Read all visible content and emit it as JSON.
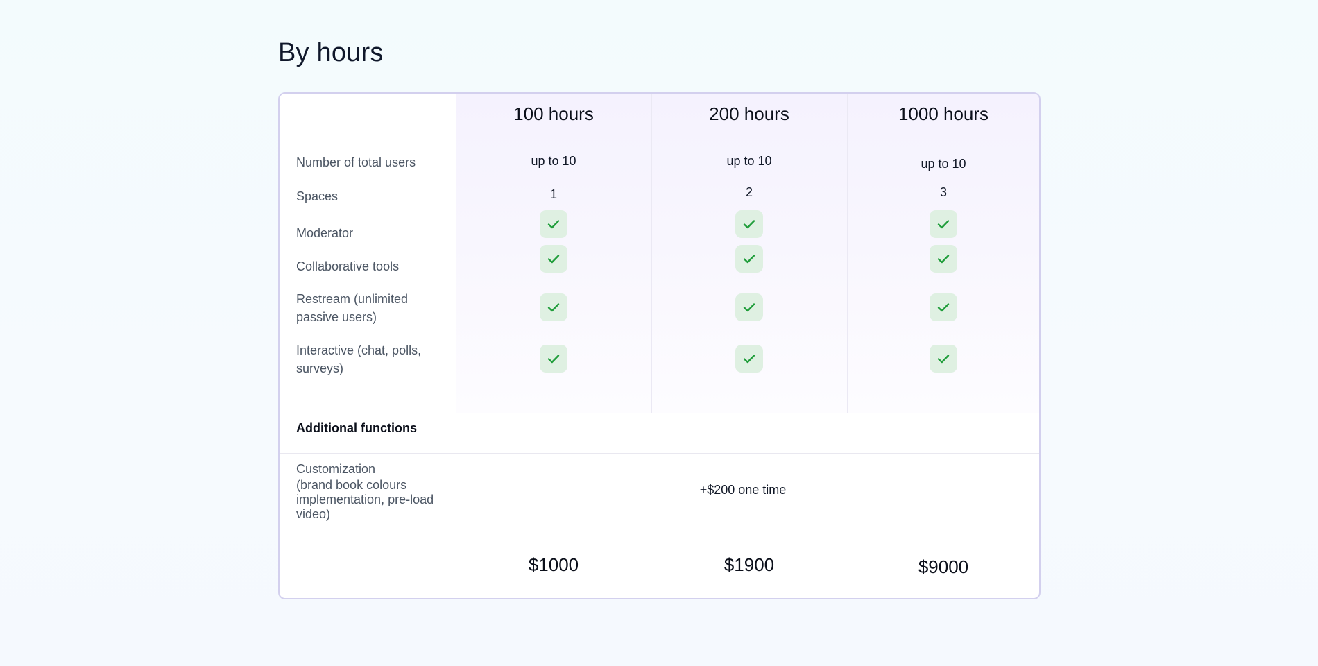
{
  "page": {
    "title": "By hours"
  },
  "plans": [
    {
      "name": "100 hours",
      "users": "up to 10",
      "spaces": "1",
      "price": "$1000"
    },
    {
      "name": "200 hours",
      "users": "up to 10",
      "spaces": "2",
      "price": "$1900"
    },
    {
      "name": "1000 hours",
      "users": "up to 10",
      "spaces": "3",
      "price": "$9000"
    }
  ],
  "features": {
    "users_label": "Number of total users",
    "spaces_label": "Spaces",
    "moderator_label": "Moderator",
    "collab_label": "Collaborative tools",
    "restream_label": "Restream (unlimited passive users)",
    "interactive_label": "Interactive (chat, polls, surveys)"
  },
  "included": {
    "moderator": [
      true,
      true,
      true
    ],
    "collab": [
      true,
      true,
      true
    ],
    "restream": [
      true,
      true,
      true
    ],
    "interactive": [
      true,
      true,
      true
    ]
  },
  "additional": {
    "section_label": "Additional functions",
    "customization_label": "Customization",
    "customization_note": "(brand book colours implementation, pre-load video)",
    "customization_price": "+$200 one time"
  },
  "colors": {
    "accent_border": "#d3d0ee",
    "check_bg": "#dff0e2",
    "check_mark": "#1f9d3a",
    "plan_column_bg": "#f5f2fe"
  },
  "icons": {
    "included": "check-icon"
  }
}
